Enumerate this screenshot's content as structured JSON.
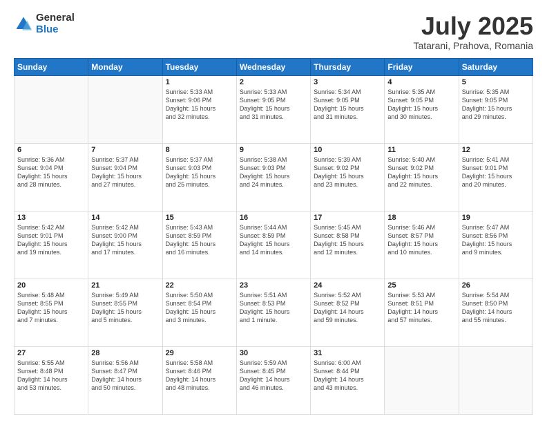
{
  "logo": {
    "general": "General",
    "blue": "Blue"
  },
  "header": {
    "month": "July 2025",
    "location": "Tatarani, Prahova, Romania"
  },
  "weekdays": [
    "Sunday",
    "Monday",
    "Tuesday",
    "Wednesday",
    "Thursday",
    "Friday",
    "Saturday"
  ],
  "weeks": [
    [
      {
        "day": "",
        "info": ""
      },
      {
        "day": "",
        "info": ""
      },
      {
        "day": "1",
        "info": "Sunrise: 5:33 AM\nSunset: 9:06 PM\nDaylight: 15 hours\nand 32 minutes."
      },
      {
        "day": "2",
        "info": "Sunrise: 5:33 AM\nSunset: 9:05 PM\nDaylight: 15 hours\nand 31 minutes."
      },
      {
        "day": "3",
        "info": "Sunrise: 5:34 AM\nSunset: 9:05 PM\nDaylight: 15 hours\nand 31 minutes."
      },
      {
        "day": "4",
        "info": "Sunrise: 5:35 AM\nSunset: 9:05 PM\nDaylight: 15 hours\nand 30 minutes."
      },
      {
        "day": "5",
        "info": "Sunrise: 5:35 AM\nSunset: 9:05 PM\nDaylight: 15 hours\nand 29 minutes."
      }
    ],
    [
      {
        "day": "6",
        "info": "Sunrise: 5:36 AM\nSunset: 9:04 PM\nDaylight: 15 hours\nand 28 minutes."
      },
      {
        "day": "7",
        "info": "Sunrise: 5:37 AM\nSunset: 9:04 PM\nDaylight: 15 hours\nand 27 minutes."
      },
      {
        "day": "8",
        "info": "Sunrise: 5:37 AM\nSunset: 9:03 PM\nDaylight: 15 hours\nand 25 minutes."
      },
      {
        "day": "9",
        "info": "Sunrise: 5:38 AM\nSunset: 9:03 PM\nDaylight: 15 hours\nand 24 minutes."
      },
      {
        "day": "10",
        "info": "Sunrise: 5:39 AM\nSunset: 9:02 PM\nDaylight: 15 hours\nand 23 minutes."
      },
      {
        "day": "11",
        "info": "Sunrise: 5:40 AM\nSunset: 9:02 PM\nDaylight: 15 hours\nand 22 minutes."
      },
      {
        "day": "12",
        "info": "Sunrise: 5:41 AM\nSunset: 9:01 PM\nDaylight: 15 hours\nand 20 minutes."
      }
    ],
    [
      {
        "day": "13",
        "info": "Sunrise: 5:42 AM\nSunset: 9:01 PM\nDaylight: 15 hours\nand 19 minutes."
      },
      {
        "day": "14",
        "info": "Sunrise: 5:42 AM\nSunset: 9:00 PM\nDaylight: 15 hours\nand 17 minutes."
      },
      {
        "day": "15",
        "info": "Sunrise: 5:43 AM\nSunset: 8:59 PM\nDaylight: 15 hours\nand 16 minutes."
      },
      {
        "day": "16",
        "info": "Sunrise: 5:44 AM\nSunset: 8:59 PM\nDaylight: 15 hours\nand 14 minutes."
      },
      {
        "day": "17",
        "info": "Sunrise: 5:45 AM\nSunset: 8:58 PM\nDaylight: 15 hours\nand 12 minutes."
      },
      {
        "day": "18",
        "info": "Sunrise: 5:46 AM\nSunset: 8:57 PM\nDaylight: 15 hours\nand 10 minutes."
      },
      {
        "day": "19",
        "info": "Sunrise: 5:47 AM\nSunset: 8:56 PM\nDaylight: 15 hours\nand 9 minutes."
      }
    ],
    [
      {
        "day": "20",
        "info": "Sunrise: 5:48 AM\nSunset: 8:55 PM\nDaylight: 15 hours\nand 7 minutes."
      },
      {
        "day": "21",
        "info": "Sunrise: 5:49 AM\nSunset: 8:55 PM\nDaylight: 15 hours\nand 5 minutes."
      },
      {
        "day": "22",
        "info": "Sunrise: 5:50 AM\nSunset: 8:54 PM\nDaylight: 15 hours\nand 3 minutes."
      },
      {
        "day": "23",
        "info": "Sunrise: 5:51 AM\nSunset: 8:53 PM\nDaylight: 15 hours\nand 1 minute."
      },
      {
        "day": "24",
        "info": "Sunrise: 5:52 AM\nSunset: 8:52 PM\nDaylight: 14 hours\nand 59 minutes."
      },
      {
        "day": "25",
        "info": "Sunrise: 5:53 AM\nSunset: 8:51 PM\nDaylight: 14 hours\nand 57 minutes."
      },
      {
        "day": "26",
        "info": "Sunrise: 5:54 AM\nSunset: 8:50 PM\nDaylight: 14 hours\nand 55 minutes."
      }
    ],
    [
      {
        "day": "27",
        "info": "Sunrise: 5:55 AM\nSunset: 8:48 PM\nDaylight: 14 hours\nand 53 minutes."
      },
      {
        "day": "28",
        "info": "Sunrise: 5:56 AM\nSunset: 8:47 PM\nDaylight: 14 hours\nand 50 minutes."
      },
      {
        "day": "29",
        "info": "Sunrise: 5:58 AM\nSunset: 8:46 PM\nDaylight: 14 hours\nand 48 minutes."
      },
      {
        "day": "30",
        "info": "Sunrise: 5:59 AM\nSunset: 8:45 PM\nDaylight: 14 hours\nand 46 minutes."
      },
      {
        "day": "31",
        "info": "Sunrise: 6:00 AM\nSunset: 8:44 PM\nDaylight: 14 hours\nand 43 minutes."
      },
      {
        "day": "",
        "info": ""
      },
      {
        "day": "",
        "info": ""
      }
    ]
  ]
}
